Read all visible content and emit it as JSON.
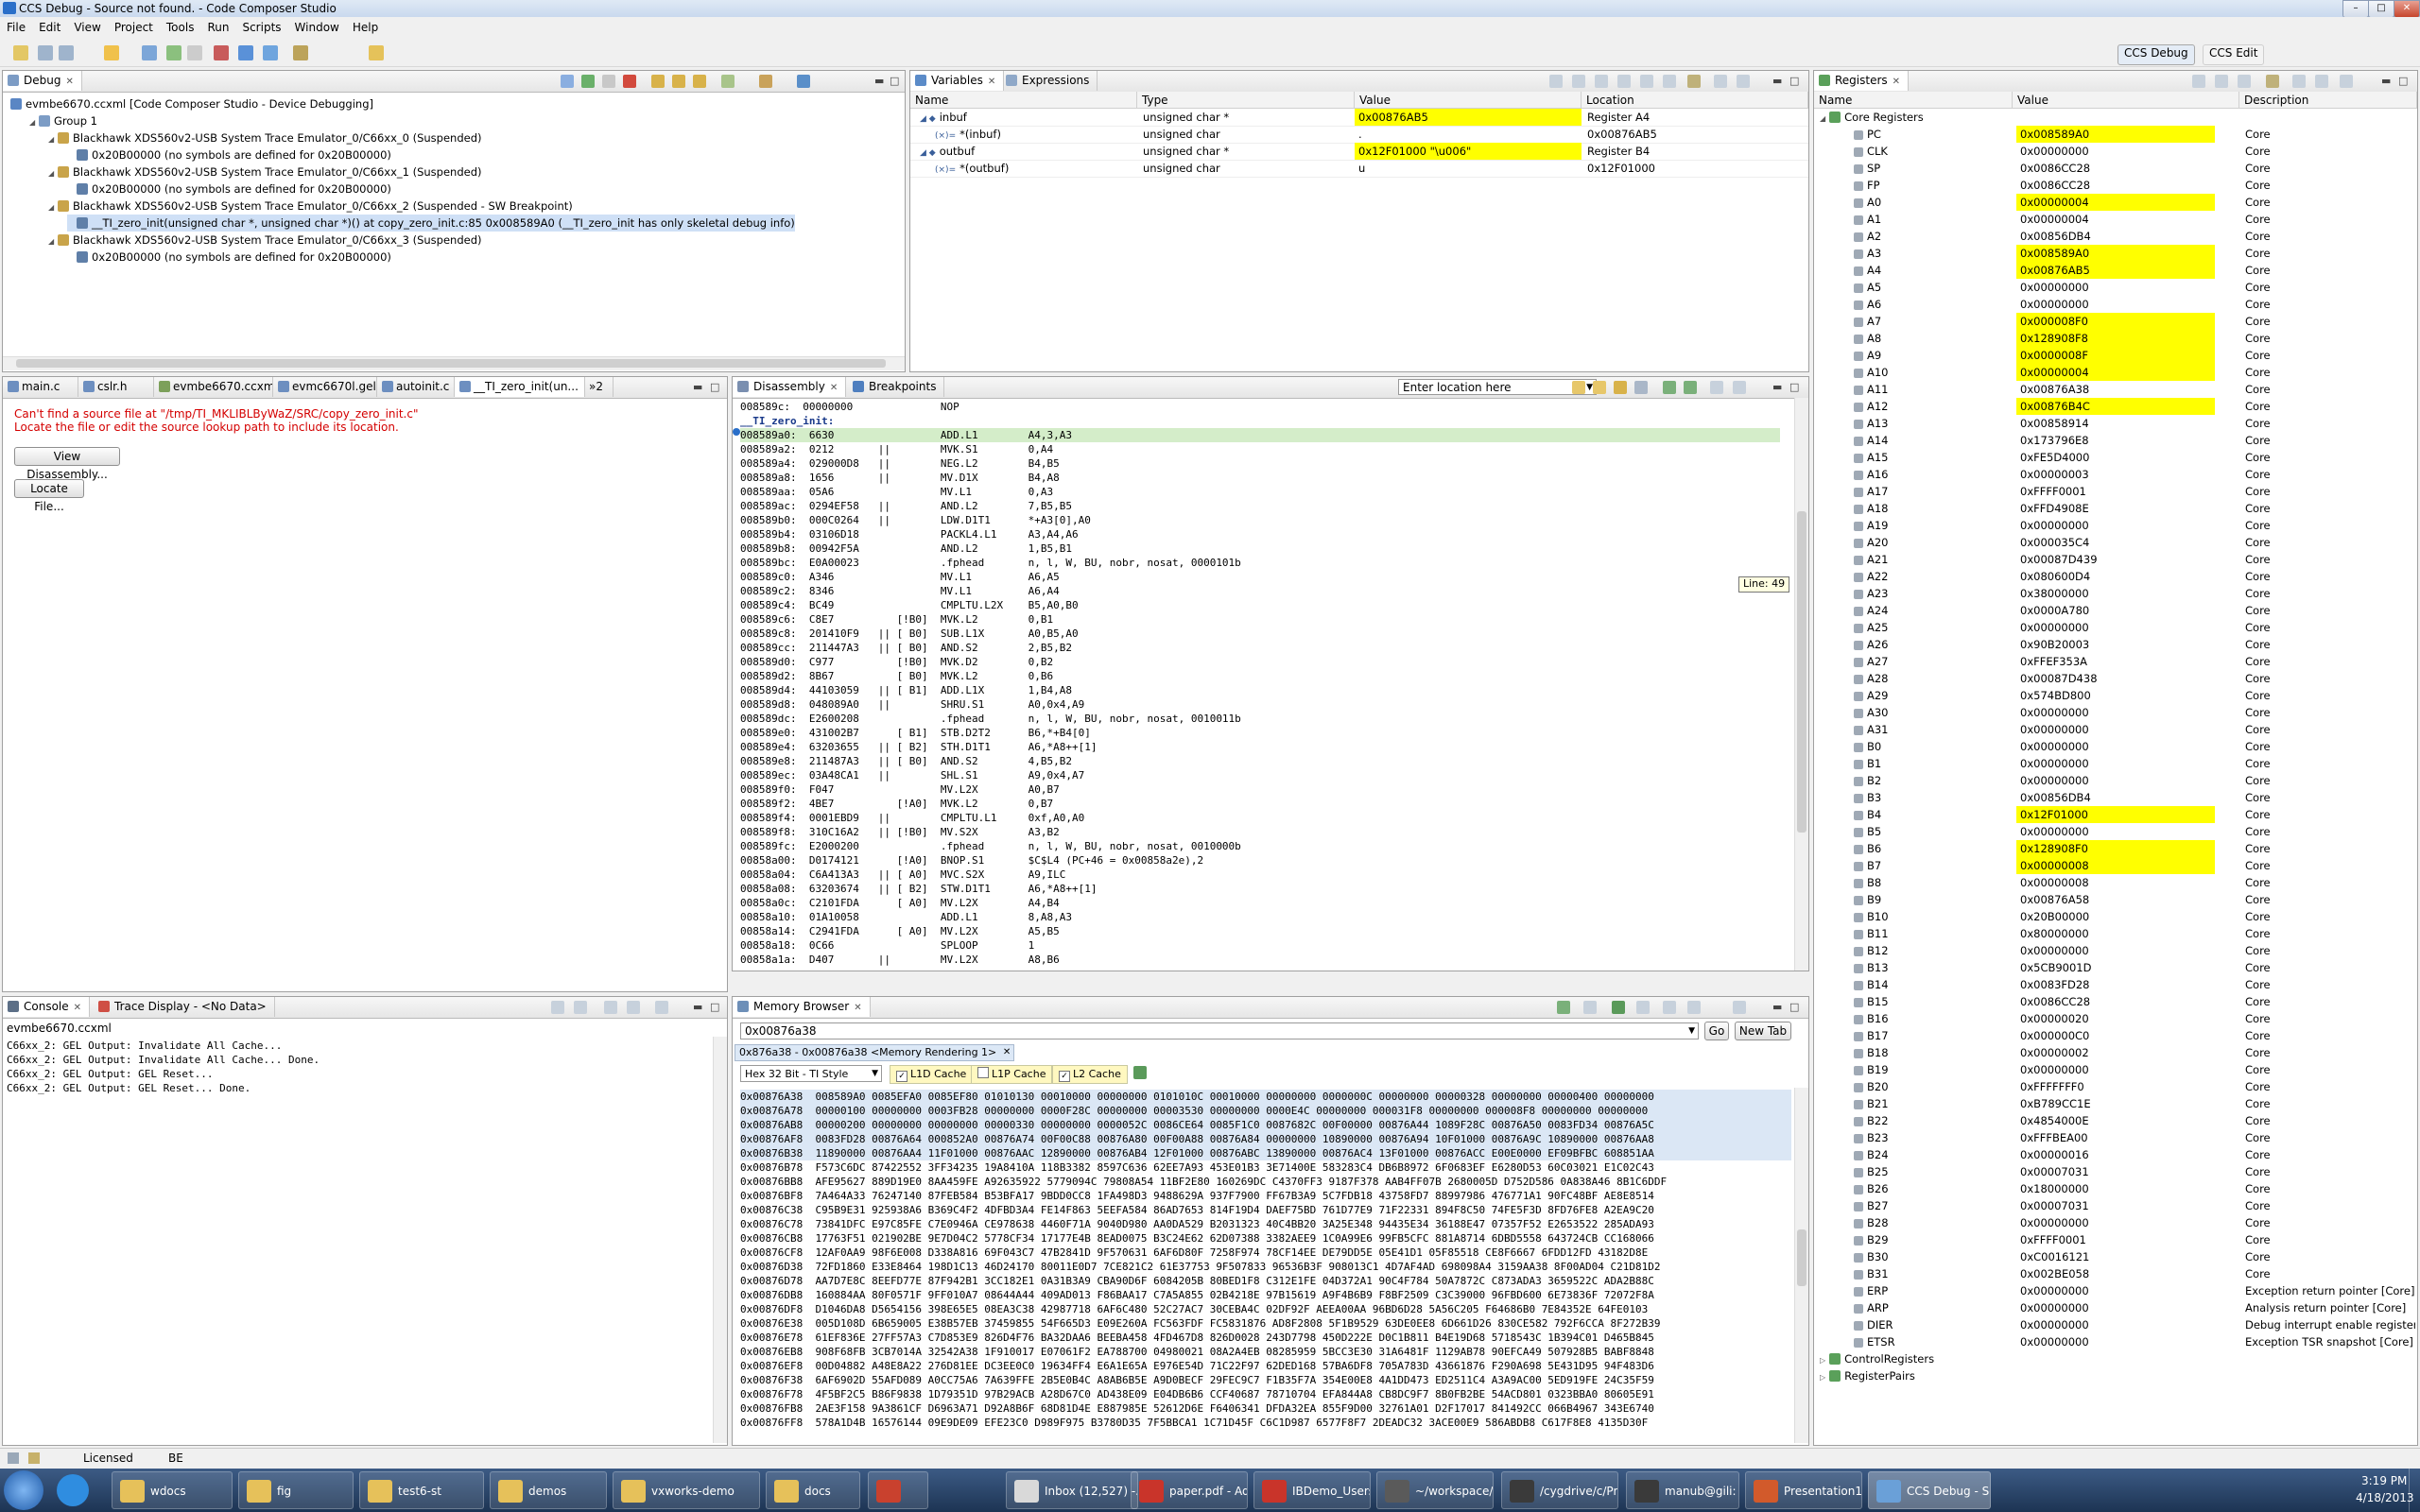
{
  "window": {
    "title": "CCS Debug - Source not found. - Code Composer Studio"
  },
  "menu": [
    "File",
    "Edit",
    "View",
    "Project",
    "Tools",
    "Run",
    "Scripts",
    "Window",
    "Help"
  ],
  "perspectives": [
    "CCS Debug",
    "CCS Edit"
  ],
  "debug": {
    "tab": "Debug",
    "tree": [
      {
        "indent": 0,
        "text": "evmbe6670.ccxml [Code Composer Studio - Device Debugging]"
      },
      {
        "indent": 1,
        "text": "Group 1"
      },
      {
        "indent": 2,
        "text": "Blackhawk XDS560v2-USB System Trace Emulator_0/C66xx_0 (Suspended)"
      },
      {
        "indent": 3,
        "text": "0x20B00000  (no symbols are defined for 0x20B00000)"
      },
      {
        "indent": 2,
        "text": "Blackhawk XDS560v2-USB System Trace Emulator_0/C66xx_1 (Suspended)"
      },
      {
        "indent": 3,
        "text": "0x20B00000  (no symbols are defined for 0x20B00000)"
      },
      {
        "indent": 2,
        "text": "Blackhawk XDS560v2-USB System Trace Emulator_0/C66xx_2 (Suspended - SW Breakpoint)"
      },
      {
        "indent": 3,
        "text": "__TI_zero_init(unsigned char *, unsigned char *)() at copy_zero_init.c:85 0x008589A0  (__TI_zero_init has only skeletal debug info)"
      },
      {
        "indent": 2,
        "text": "Blackhawk XDS560v2-USB System Trace Emulator_0/C66xx_3 (Suspended)"
      },
      {
        "indent": 3,
        "text": "0x20B00000  (no symbols are defined for 0x20B00000)"
      }
    ]
  },
  "variables": {
    "tabs": [
      "Variables",
      "Expressions"
    ],
    "headers": [
      "Name",
      "Type",
      "Value",
      "Location"
    ],
    "rows": [
      {
        "name": "inbuf",
        "type": "unsigned char *",
        "value": "0x00876AB5",
        "location": "Register A4",
        "hl": true,
        "sub": false
      },
      {
        "name": "*(inbuf)",
        "type": "unsigned char",
        "value": ".",
        "location": "0x00876AB5",
        "hl": false,
        "sub": true
      },
      {
        "name": "outbuf",
        "type": "unsigned char *",
        "value": "0x12F01000 \"\\u006\"",
        "location": "Register B4",
        "hl": true,
        "sub": false
      },
      {
        "name": "*(outbuf)",
        "type": "unsigned char",
        "value": "u",
        "location": "0x12F01000",
        "hl": false,
        "sub": true
      }
    ]
  },
  "registers": {
    "tab": "Registers",
    "headers": [
      "Name",
      "Value",
      "Description"
    ],
    "group": "Core Registers",
    "rows": [
      [
        "PC",
        "0x008589A0",
        "Core",
        true
      ],
      [
        "CLK",
        "0x00000000",
        "Core",
        false
      ],
      [
        "SP",
        "0x0086CC28",
        "Core",
        false
      ],
      [
        "FP",
        "0x0086CC28",
        "Core",
        false
      ],
      [
        "A0",
        "0x00000004",
        "Core",
        true
      ],
      [
        "A1",
        "0x00000004",
        "Core",
        false
      ],
      [
        "A2",
        "0x00856DB4",
        "Core",
        false
      ],
      [
        "A3",
        "0x008589A0",
        "Core",
        true
      ],
      [
        "A4",
        "0x00876AB5",
        "Core",
        true
      ],
      [
        "A5",
        "0x00000000",
        "Core",
        false
      ],
      [
        "A6",
        "0x00000000",
        "Core",
        false
      ],
      [
        "A7",
        "0x000008F0",
        "Core",
        true
      ],
      [
        "A8",
        "0x128908F8",
        "Core",
        true
      ],
      [
        "A9",
        "0x0000008F",
        "Core",
        true
      ],
      [
        "A10",
        "0x00000004",
        "Core",
        true
      ],
      [
        "A11",
        "0x00876A38",
        "Core",
        false
      ],
      [
        "A12",
        "0x00876B4C",
        "Core",
        true
      ],
      [
        "A13",
        "0x00858914",
        "Core",
        false
      ],
      [
        "A14",
        "0x173796E8",
        "Core",
        false
      ],
      [
        "A15",
        "0xFE5D4000",
        "Core",
        false
      ],
      [
        "A16",
        "0x00000003",
        "Core",
        false
      ],
      [
        "A17",
        "0xFFFF0001",
        "Core",
        false
      ],
      [
        "A18",
        "0xFFD4908E",
        "Core",
        false
      ],
      [
        "A19",
        "0x00000000",
        "Core",
        false
      ],
      [
        "A20",
        "0x000035C4",
        "Core",
        false
      ],
      [
        "A21",
        "0x00087D439",
        "Core",
        false
      ],
      [
        "A22",
        "0x080600D4",
        "Core",
        false
      ],
      [
        "A23",
        "0x38000000",
        "Core",
        false
      ],
      [
        "A24",
        "0x0000A780",
        "Core",
        false
      ],
      [
        "A25",
        "0x00000000",
        "Core",
        false
      ],
      [
        "A26",
        "0x90B20003",
        "Core",
        false
      ],
      [
        "A27",
        "0xFFEF353A",
        "Core",
        false
      ],
      [
        "A28",
        "0x00087D438",
        "Core",
        false
      ],
      [
        "A29",
        "0x574BD800",
        "Core",
        false
      ],
      [
        "A30",
        "0x00000000",
        "Core",
        false
      ],
      [
        "A31",
        "0x00000000",
        "Core",
        false
      ],
      [
        "B0",
        "0x00000000",
        "Core",
        false
      ],
      [
        "B1",
        "0x00000000",
        "Core",
        false
      ],
      [
        "B2",
        "0x00000000",
        "Core",
        false
      ],
      [
        "B3",
        "0x00856DB4",
        "Core",
        false
      ],
      [
        "B4",
        "0x12F01000",
        "Core",
        true
      ],
      [
        "B5",
        "0x00000000",
        "Core",
        false
      ],
      [
        "B6",
        "0x128908F0",
        "Core",
        true
      ],
      [
        "B7",
        "0x00000008",
        "Core",
        true
      ],
      [
        "B8",
        "0x00000008",
        "Core",
        false
      ],
      [
        "B9",
        "0x00876A58",
        "Core",
        false
      ],
      [
        "B10",
        "0x20B00000",
        "Core",
        false
      ],
      [
        "B11",
        "0x80000000",
        "Core",
        false
      ],
      [
        "B12",
        "0x00000000",
        "Core",
        false
      ],
      [
        "B13",
        "0x5CB9001D",
        "Core",
        false
      ],
      [
        "B14",
        "0x0083FD28",
        "Core",
        false
      ],
      [
        "B15",
        "0x0086CC28",
        "Core",
        false
      ],
      [
        "B16",
        "0x00000020",
        "Core",
        false
      ],
      [
        "B17",
        "0x000000C0",
        "Core",
        false
      ],
      [
        "B18",
        "0x00000002",
        "Core",
        false
      ],
      [
        "B19",
        "0x00000000",
        "Core",
        false
      ],
      [
        "B20",
        "0xFFFFFFF0",
        "Core",
        false
      ],
      [
        "B21",
        "0xB789CC1E",
        "Core",
        false
      ],
      [
        "B22",
        "0x4854000E",
        "Core",
        false
      ],
      [
        "B23",
        "0xFFFBEA00",
        "Core",
        false
      ],
      [
        "B24",
        "0x00000016",
        "Core",
        false
      ],
      [
        "B25",
        "0x00007031",
        "Core",
        false
      ],
      [
        "B26",
        "0x18000000",
        "Core",
        false
      ],
      [
        "B27",
        "0x00007031",
        "Core",
        false
      ],
      [
        "B28",
        "0x00000000",
        "Core",
        false
      ],
      [
        "B29",
        "0xFFFF0001",
        "Core",
        false
      ],
      [
        "B30",
        "0xC0016121",
        "Core",
        false
      ],
      [
        "B31",
        "0x002BE058",
        "Core",
        false
      ],
      [
        "ERP",
        "0x00000000",
        "Exception return pointer [Core]",
        false
      ],
      [
        "ARP",
        "0x00000000",
        "Analysis return pointer [Core]",
        false
      ],
      [
        "DIER",
        "0x00000000",
        "Debug interrupt enable register [Core]",
        false
      ],
      [
        "ETSR",
        "0x00000000",
        "Exception TSR snapshot [Core]",
        false
      ]
    ],
    "groups_after": [
      "ControlRegisters",
      "RegisterPairs"
    ]
  },
  "editor": {
    "tabs": [
      "main.c",
      "cslr.h",
      "evmbe6670.ccxml",
      "evmc6670l.gel",
      "autoinit.c",
      "__TI_zero_init(un...",
      "»2"
    ],
    "error_line1": "Can't find a source file at \"/tmp/TI_MKLIBLByWaZ/SRC/copy_zero_init.c\"",
    "error_line2": "Locate the file or edit the source lookup path to include its location.",
    "view_disassembly": "View Disassembly...",
    "locate_file": "Locate File..."
  },
  "disassembly": {
    "tabs": [
      "Disassembly",
      "Breakpoints"
    ],
    "location_placeholder": "Enter location here",
    "tooltip": "Line: 49",
    "lines": [
      "008589c:  00000000              NOP",
      "__TI_zero_init:",
      "008589a0:  6630                 ADD.L1        A4,3,A3",
      "008589a2:  0212       ||        MVK.S1        0,A4",
      "008589a4:  029000D8   ||        NEG.L2        B4,B5",
      "008589a8:  1656       ||        MV.D1X        B4,A8",
      "008589aa:  05A6                 MV.L1         0,A3",
      "008589ac:  0294EF58   ||        AND.L2        7,B5,B5",
      "008589b0:  000C0264   ||        LDW.D1T1      *+A3[0],A0",
      "008589b4:  03106D18             PACKL4.L1     A3,A4,A6",
      "008589b8:  00942F5A             AND.L2        1,B5,B1",
      "008589bc:  E0A00023             .fphead       n, l, W, BU, nobr, nosat, 0000101b",
      "008589c0:  A346                 MV.L1         A6,A5",
      "008589c2:  8346                 MV.L1         A6,A4",
      "008589c4:  BC49                 CMPLTU.L2X    B5,A0,B0",
      "008589c6:  C8E7          [!B0]  MVK.L2        0,B1",
      "008589c8:  201410F9   || [ B0]  SUB.L1X       A0,B5,A0",
      "008589cc:  211447A3   || [ B0]  AND.S2        2,B5,B2",
      "008589d0:  C977          [!B0]  MVK.D2        0,B2",
      "008589d2:  8B67          [ B0]  MVK.L2        0,B6",
      "008589d4:  44103059   || [ B1]  ADD.L1X       1,B4,A8",
      "008589d8:  048089A0   ||        SHRU.S1       A0,0x4,A9",
      "008589dc:  E2600208             .fphead       n, l, W, BU, nobr, nosat, 0010011b",
      "008589e0:  431002B7      [ B1]  STB.D2T2      B6,*+B4[0]",
      "008589e4:  63203655   || [ B2]  STH.D1T1      A6,*A8++[1]",
      "008589e8:  211487A3   || [ B0]  AND.S2        4,B5,B2",
      "008589ec:  03A48CA1   ||        SHL.S1        A9,0x4,A7",
      "008589f0:  F047                 MV.L2X        A0,B7",
      "008589f2:  4BE7          [!A0]  MVK.L2        0,B7",
      "008589f4:  0001EBD9   ||        CMPLTU.L1     0xf,A0,A0",
      "008589f8:  310C16A2   || [!B0]  MV.S2X        A3,B2",
      "008589fc:  E2000200             .fphead       n, l, W, BU, nobr, nosat, 0010000b",
      "00858a00:  D0174121      [!A0]  BNOP.S1       $C$L4 (PC+46 = 0x00858a2e),2",
      "00858a04:  C6A413A3   || [ A0]  MVC.S2X       A9,ILC",
      "00858a08:  63203674   || [ B2]  STW.D1T1      A6,*A8++[1]",
      "00858a0c:  C2101FDA      [ A0]  MV.L2X        A4,B4",
      "00858a10:  01A10058             ADD.L1        8,A8,A3",
      "00858a14:  C2941FDA      [ A0]  MV.L2X        A5,B5",
      "00858a18:  0C66                 SPLOOP        1",
      "00858a1a:  D407       ||        MV.L2X        A8,B6"
    ]
  },
  "console": {
    "tabs": [
      "Console",
      "Trace Display - <No Data>"
    ],
    "name": "evmbe6670.ccxml",
    "lines": [
      "C66xx_2: GEL Output: Invalidate All Cache...",
      "C66xx_2: GEL Output: Invalidate All Cache... Done.",
      "C66xx_2: GEL Output: GEL Reset...",
      "C66xx_2: GEL Output: GEL Reset... Done."
    ]
  },
  "memory": {
    "tab": "Memory Browser",
    "address_input": "0x00876a38",
    "go": "Go",
    "new_tab": "New Tab",
    "rendering_tab": "0x876a38 - 0x00876a38 <Memory Rendering 1>",
    "format": "Hex 32 Bit - TI Style",
    "caches": [
      "L1D Cache",
      "L1P Cache",
      "L2 Cache"
    ],
    "lines": [
      "0x00876A38  008589A0 0085EFA0 0085EF80 01010130 00010000 00000000 0101010C 00010000 00000000 0000000C 00000000 00000328 00000000 00000400 00000000",
      "0x00876A78  00000100 00000000 0003FB28 00000000 0000F28C 00000000 00003530 00000000 0000E4C 00000000 000031F8 00000000 000008F8 00000000 00000000",
      "0x00876AB8  00000200 00000000 00000000 00000330 00000000 0000052C 0086CE64 0085F1C0 0087682C 00F00000 00876A44 1089F28C 00876A50 0083FD34 00876A5C",
      "0x00876AF8  0083FD28 00876A64 000852A0 00876A74 00F00C88 00876A80 00F00A88 00876A84 00000000 10890000 00876A94 10F01000 00876A9C 10890000 00876AA8",
      "0x00876B38  11890000 00876AA4 11F01000 00876AAC 12890000 00876AB4 12F01000 00876ABC 13890000 00876AC4 13F01000 00876ACC E00E0000 EF09BFBC 608851AA",
      "0x00876B78  F573C6DC 87422552 3FF34235 19A8410A 118B3382 8597C636 62EE7A93 453E01B3 3E71400E 583283C4 DB6B8972 6F0683EF E6280D53 60C03021 E1C02C43",
      "0x00876BB8  AFE95627 889D19E0 8AA459FE A92635922 5779094C 79808A54 11BF2E80 160269DC C4370FF3 9187F378 AAB4FF07B 2680005D D752D586 0A838A46 8B1C6DDF",
      "0x00876BF8  7A464A33 76247140 87FEB584 B53BFA17 9BDD0CC8 1FA498D3 9488629A 937F7900 FF67B3A9 5C7FDB18 43758FD7 88997986 476771A1 90FC48BF AE8E8514",
      "0x00876C38  C95B9E31 925938A6 B369C4F2 4DFBD3A4 FE14F863 5EEFA584 86AD7653 814F19D4 DAEF75BD 761D77E9 71F22331 894F8C50 74FE5F3D 8FD76FE8 A2EA9C20",
      "0x00876C78  73841DFC E97C85FE C7E0946A CE978638 4460F71A 9040D980 AA0DA529 B2031323 40C4BB20 3A25E348 94435E34 36188E47 07357F52 E2653522 285ADA93",
      "0x00876CB8  17763F51 021902BE 9E7D04C2 5778CF34 17177E4B 8EAD0075 B3C24E62 62D07388 3382AEE9 1C0A99E6 99FB5CFC 881A8714 6DBD5558 643724CB CC168066",
      "0x00876CF8  12AF0AA9 98F6E008 D338A816 69F043C7 47B2841D 9F570631 6AF6D80F 7258F974 78CF14EE DE79DD5E 05E41D1 05F85518 CE8F6667 6FDD12FD 43182D8E",
      "0x00876D38  72FD1860 E33E8464 198D1C13 46D24170 80011E0D7 7CE821C2 61E37753 9F507833 96536B3F 908013C1 4D7AF4AD 698098A4 3159AA38 8F00AD04 C21D81D2",
      "0x00876D78  AA7D7E8C 8EEFD77E 87F942B1 3CC182E1 0A31B3A9 CBA90D6F 6084205B 80BED1F8 C312E1FE 04D372A1 90C4F784 50A7872C C873ADA3 3659522C ADA2B88C",
      "0x00876DB8  160884AA 80F0571F 9FF010A7 08644A44 409AD013 F86BAA17 C7A5A855 02B4218E 97B15619 A9F4B6B9 F8BF2509 C3C39000 96FBD600 6E73836F 72072F8A",
      "0x00876DF8  D1046DA8 D5654156 398E65E5 08EA3C38 42987718 6AF6C480 52C27AC7 30CEBA4C 02DF92F AEEA00AA 96BD6D28 5A56C205 F64686B0 7E84352E 64FE0103",
      "0x00876E38  005D108D 6B659005 E38B57EB 37459855 54F665D3 E09E260A FC563FDF FC5831876 AD8F2808 5F1B9529 63DE0EE8 6D661D26 830CE582 792F6CCA 8F272B39",
      "0x00876E78  61EF836E 27FF57A3 C7D853E9 826D4F76 BA32DAA6 BEEBA458 4FD467D8 826D0028 243D7798 450D222E D0C1B811 B4E19D68 5718543C 1B394C01 D465B845",
      "0x00876EB8  908F68FB 3CB7014A 32542A38 1F910017 E07061F2 EA788700 04980021 08A2A4EB 08285959 5BCC3E30 31A6481F 1129AB78 90EFCA49 507928B5 BABF8848",
      "0x00876EF8  00D04882 A48E8A22 276D81EE DC3EE0C0 19634FF4 E6A1E65A E976E54D 71C22F97 62DED168 57BA6DF8 705A783D 43661876 F290A698 5E431D95 94F483D6",
      "0x00876F38  6AF6902D 55AFD089 A0CC75A6 7A639FFE 2B5E0B4C A8AB6B5E A9D0BECF 29FEC9C7 F1B35F7A 354E00E8 4A1DD473 ED2511C4 A3A9AC00 5ED919FE 24C35F59",
      "0x00876F78  4F5BF2C5 B86F9838 1D79351D 97B29ACB A28D67C0 AD438E09 E04DB6B6 CCF40687 78710704 EFA844A8 CB8DC9F7 8B0FB2BE 54ACD801 0323BBA0 80605E91",
      "0x00876FB8  2AE3F158 9A3861CF D6963A71 D92A8B6F 68D81D4E E887985E 52612D6E F6406341 DFDA32EA 855F9D00 32761A01 D2F17017 841492CC 066B4967 343E6740",
      "0x00876FF8  578A1D4B 16576144 09E9DE09 EFE23C0 D989F975 B3780D35 7F5BBCA1 1C71D45F C6C1D987 6577F8F7 2DEADC32 3ACE00E9 586ABDB8 C617F8E8 4135D30F"
    ]
  },
  "status": {
    "licensed": "Licensed",
    "be": "BE"
  },
  "taskbar": {
    "items": [
      "wdocs",
      "fig",
      "test6-st",
      "demos",
      "vxworks-demo",
      "docs",
      "",
      "Inbox (12,527) -...",
      "paper.pdf - Ado...",
      "IBDemo_Users_M...",
      "~/workspace/or...",
      "/cygdrive/c/Pro...",
      "manub@gili: ~",
      "Presentation1 -...",
      "CCS Debug - So..."
    ],
    "time": "3:19 PM",
    "date": "4/18/2013"
  }
}
